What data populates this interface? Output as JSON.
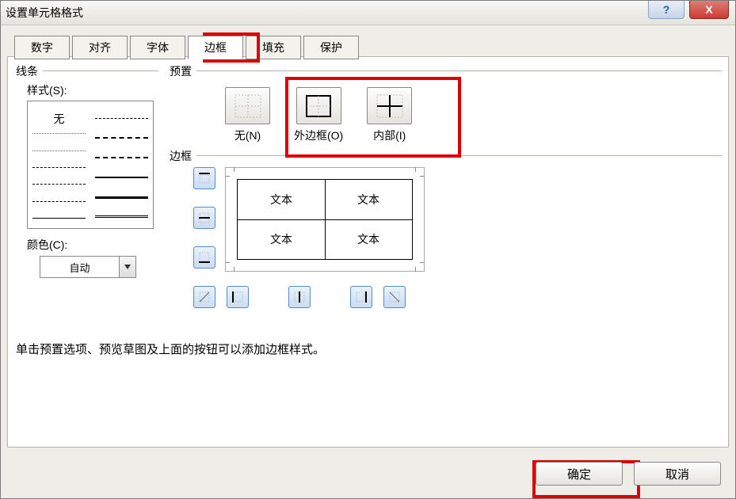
{
  "window": {
    "title": "设置单元格格式"
  },
  "tabs": [
    "数字",
    "对齐",
    "字体",
    "边框",
    "填充",
    "保护"
  ],
  "active_tab": "边框",
  "line": {
    "group": "线条",
    "style_label": "样式(S):",
    "none_label": "无",
    "color_label": "颜色(C):",
    "color_value": "自动"
  },
  "presets": {
    "group": "预置",
    "items": [
      {
        "label": "无(N)"
      },
      {
        "label": "外边框(O)"
      },
      {
        "label": "内部(I)"
      }
    ]
  },
  "border": {
    "group": "边框",
    "sample_text": "文本"
  },
  "hint": "单击预置选项、预览草图及上面的按钮可以添加边框样式。",
  "buttons": {
    "ok": "确定",
    "cancel": "取消"
  },
  "titlebar_ctrls": {
    "help": "?",
    "close": "X"
  }
}
